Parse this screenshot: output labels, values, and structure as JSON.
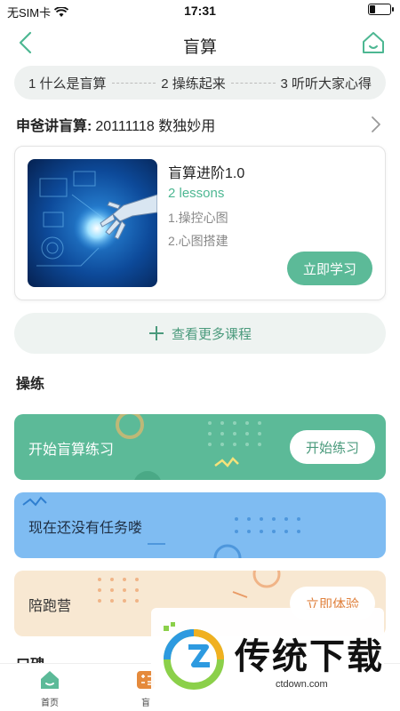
{
  "status_bar": {
    "carrier": "无SIM卡",
    "time": "17:31"
  },
  "nav": {
    "title": "盲算"
  },
  "steps": [
    {
      "label": "1 什么是盲算"
    },
    {
      "label": "2 操练起来"
    },
    {
      "label": "3 听听大家心得"
    }
  ],
  "course_header": {
    "label": "申爸讲盲算:",
    "value": "20111118 数独妙用"
  },
  "course": {
    "title": "盲算进阶1.0",
    "lessons": "2 lessons",
    "items": [
      "1.操控心图",
      "2.心图搭建"
    ],
    "button": "立即学习"
  },
  "more_courses": "查看更多课程",
  "practice_section": {
    "title": "操练",
    "cards": [
      {
        "text": "开始盲算练习",
        "button": "开始练习",
        "color": "#5cba98"
      },
      {
        "text": "现在还没有任务喽",
        "color": "#7fbcf2"
      },
      {
        "text": "陪跑营",
        "button": "立即体验",
        "color": "#f8e8d2"
      }
    ]
  },
  "reviews_section": {
    "title": "口碑"
  },
  "tab_bar": {
    "items": [
      {
        "label": "首页",
        "icon": "home-icon"
      },
      {
        "label": "盲",
        "icon": "calc-icon"
      }
    ]
  },
  "watermark": {
    "text": "传统下载",
    "url": "ctdown.com"
  },
  "colors": {
    "accent": "#5cba98",
    "accent_dark": "#4a9a7c"
  }
}
